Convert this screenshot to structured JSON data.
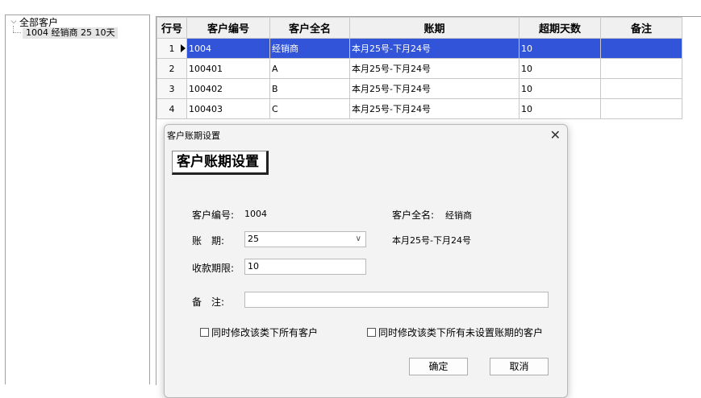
{
  "tree": {
    "root_label": "全部客户",
    "child_label": "1004 经销商 25 10天"
  },
  "grid": {
    "headers": [
      "行号",
      "客户编号",
      "客户全名",
      "账期",
      "超期天数",
      "备注"
    ],
    "rows": [
      {
        "num": "1",
        "code": "1004",
        "name": "经销商",
        "period": "本月25号-下月24号",
        "days": "10",
        "note": ""
      },
      {
        "num": "2",
        "code": "100401",
        "name": "A",
        "period": "本月25号-下月24号",
        "days": "10",
        "note": ""
      },
      {
        "num": "3",
        "code": "100402",
        "name": "B",
        "period": "本月25号-下月24号",
        "days": "10",
        "note": ""
      },
      {
        "num": "4",
        "code": "100403",
        "name": "C",
        "period": "本月25号-下月24号",
        "days": "10",
        "note": ""
      }
    ],
    "selected_color": "#3254d8"
  },
  "dialog": {
    "title": "客户账期设置",
    "header": "客户账期设置",
    "code_label": "客户编号:",
    "code_value": "1004",
    "name_label": "客户全名:",
    "name_value": "经销商",
    "period_label": "账　期:",
    "period_value": "25",
    "period_desc": "本月25号-下月24号",
    "limit_label": "收款期限:",
    "limit_value": "10",
    "note_label": "备　注:",
    "note_value": "",
    "check_all": "同时修改该类下所有客户",
    "check_unset": "同时修改该类下所有未设置账期的客户",
    "ok_label": "确定",
    "cancel_label": "取消"
  }
}
